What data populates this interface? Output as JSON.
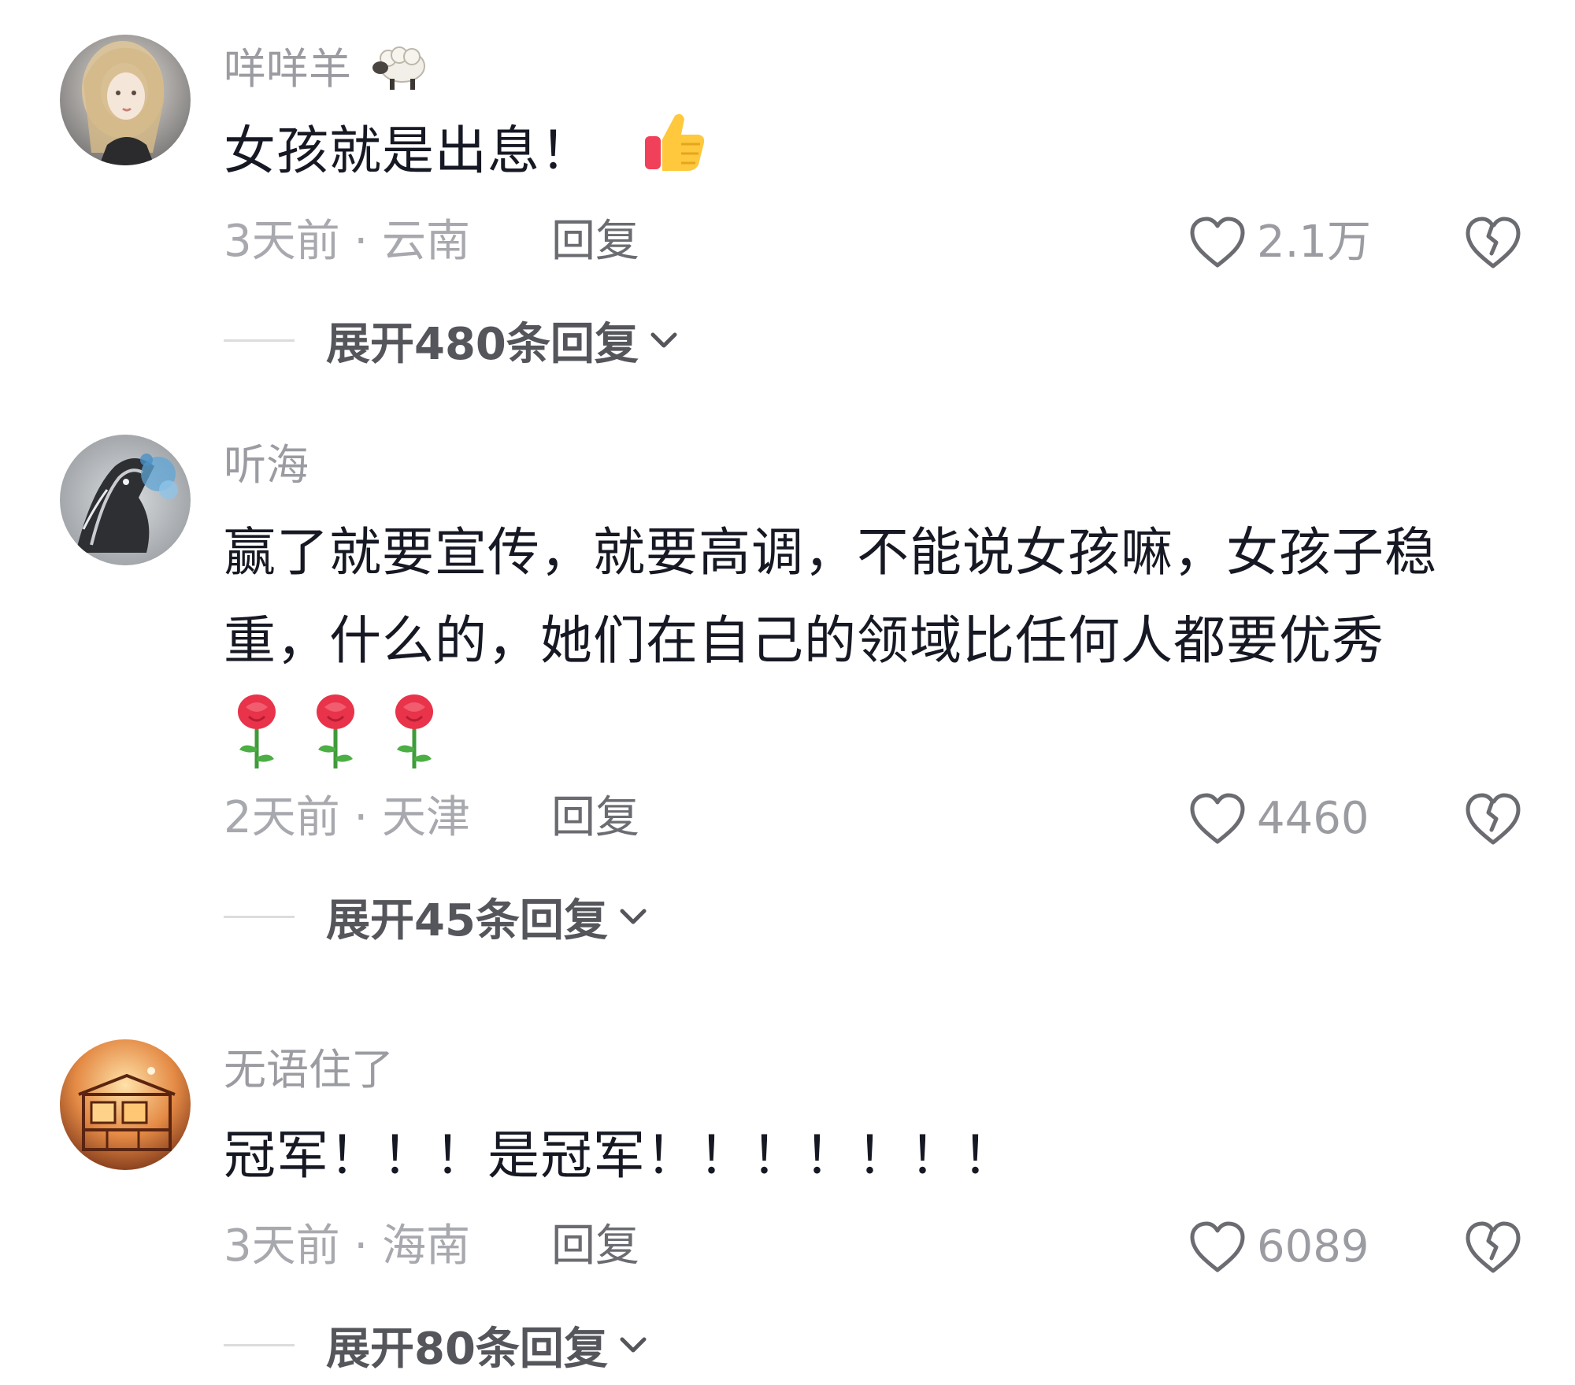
{
  "colors": {
    "text_primary": "#161823",
    "text_secondary": "#9b9ca1",
    "reply_text": "#6b6c71",
    "expand_text": "#55565b",
    "divider": "#dcdcdf"
  },
  "comments": [
    {
      "username": "咩咩羊",
      "username_emoji": "sheep",
      "text": "女孩就是出息！",
      "text_emoji": "thumbs-up",
      "time_location": "3天前 · 云南",
      "reply_label": "回复",
      "likes": "2.1万",
      "expand_label": "展开480条回复"
    },
    {
      "username": "听海",
      "text": "赢了就要宣传，就要高调，不能说女孩嘛，女孩子稳重，什么的，她们在自己的领域比任何人都要优秀",
      "text_emoji": "rose x3",
      "time_location": "2天前 · 天津",
      "reply_label": "回复",
      "likes": "4460",
      "expand_label": "展开45条回复"
    },
    {
      "username": "无语住了",
      "text": "冠军！！！是冠军！！！！！！！",
      "time_location": "3天前 · 海南",
      "reply_label": "回复",
      "likes": "6089",
      "expand_label": "展开80条回复"
    }
  ]
}
